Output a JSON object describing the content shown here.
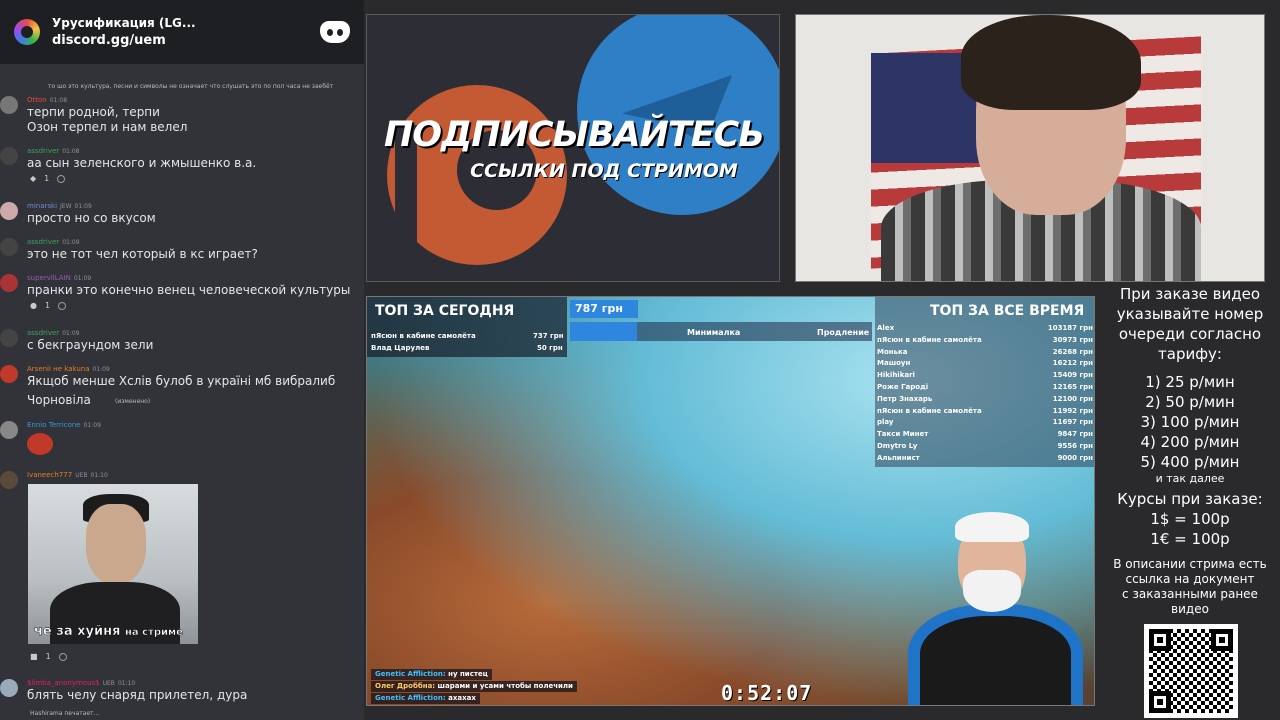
{
  "discord": {
    "server_name": "Урусификация (LG...",
    "server_link": "discord.gg/uem",
    "messages": [
      {
        "small_text": "то шо это культура, песни и символы не означает что слушать это по пол часа не заебёт"
      },
      {
        "user": "Otton",
        "color": "#e74c3c",
        "time": "01:08",
        "lines": [
          "терпи родной, терпи",
          "Озон терпел и нам велел"
        ]
      },
      {
        "user": "assdriver",
        "color": "#3ba55d",
        "time": "01:08",
        "lines": [
          "аа сын зеленского и жмышенко в.а."
        ],
        "reaction": "1"
      },
      {
        "user": "minarski",
        "color": "#7289da",
        "tag": "JEW",
        "time": "01:09",
        "lines": [
          "просто но со вкусом"
        ]
      },
      {
        "user": "assdriver",
        "color": "#3ba55d",
        "time": "01:09",
        "lines": [
          "это не тот чел который в кс играет?"
        ]
      },
      {
        "user": "supervilLAIN",
        "color": "#9b59b6",
        "time": "01:09",
        "lines": [
          "пранки это конечно венец человеческой культуры"
        ],
        "reaction": "1"
      },
      {
        "user": "assdriver",
        "color": "#3ba55d",
        "time": "01:09",
        "lines": [
          "с бекграундом зели"
        ]
      },
      {
        "user": "Arsenii не kakuna",
        "color": "#e67e22",
        "time": "01:09",
        "lines": [
          "Якщоб менше Хслів булоб в україні мб вибралиб",
          "Чорновіла"
        ],
        "edited": "(изменено)"
      },
      {
        "user": "Ennio Terricone",
        "color": "#3498db",
        "time": "01:09",
        "lines": []
      },
      {
        "user": "Ivaneech777",
        "color": "#e67e22",
        "tag": "UEB",
        "time": "01:10",
        "lines": [],
        "reaction": "1"
      },
      {
        "user": "$limba_anonymous$",
        "color": "#e91e63",
        "tag": "UEB",
        "time": "01:10",
        "lines": [
          "блять челу снаряд прилетел, дура"
        ]
      }
    ],
    "meme_caption": "че за хуйня",
    "meme_caption_small": "на стриме",
    "typing": "Hashirama печатает..."
  },
  "promo": {
    "title": "ПОДПИСЫВАЙТЕСЬ",
    "subtitle": "ССЫЛКИ ПОД СТРИМОМ"
  },
  "stream": {
    "top_today_title": "ТОП ЗА СЕГОДНЯ",
    "top_today": [
      {
        "name": "пЯсюн в кабине самолёта",
        "amount": "737 грн"
      },
      {
        "name": "Влад Царулев",
        "amount": "50 грн"
      }
    ],
    "goal_amount": "787 грн",
    "goal_label_min": "Минималка",
    "goal_label_ext": "Продление",
    "top_all_title": "ТОП ЗА ВСЕ ВРЕМЯ",
    "top_all": [
      {
        "name": "Alex",
        "amount": "103187 грн"
      },
      {
        "name": "пЯсюн в кабине самолёта",
        "amount": "30973 грн"
      },
      {
        "name": "Монька",
        "amount": "26268 грн"
      },
      {
        "name": "Машоун",
        "amount": "16212 грн"
      },
      {
        "name": "Hikihikari",
        "amount": "15409 грн"
      },
      {
        "name": "Роже Гароді",
        "amount": "12165 грн"
      },
      {
        "name": "Петр Знахарь",
        "amount": "12100 грн"
      },
      {
        "name": "пЯсюн в кабине самолёта",
        "amount": "11992 грн"
      },
      {
        "name": "play",
        "amount": "11697 грн"
      },
      {
        "name": "Такси Минет",
        "amount": "9847 грн"
      },
      {
        "name": "Dmytro Ly",
        "amount": "9556 грн"
      },
      {
        "name": "Альпинист",
        "amount": "9000 грн"
      }
    ],
    "chat": [
      {
        "name": "Genetic Affliction:",
        "text": "ну пистец"
      },
      {
        "name": "Олег Дроббна:",
        "text": "шарами и усами чтобы полечили"
      },
      {
        "name": "Genetic Affliction:",
        "text": "ахахах"
      }
    ],
    "timer": "0:52:07"
  },
  "info": {
    "intro": [
      "При заказе видео",
      "указывайте номер",
      "очереди согласно",
      "тарифу:"
    ],
    "tariffs": [
      "1) 25 р/мин",
      "2) 50 р/мин",
      "3) 100 р/мин",
      "4) 200 р/мин",
      "5) 400 р/мин"
    ],
    "etc": "и так далее",
    "rates_title": "Курсы при заказе:",
    "rates": [
      "1$ = 100р",
      "1€ = 100р"
    ],
    "desc": [
      "В описании стрима есть",
      "ссылка на документ",
      "с заказанными ранее",
      "видео"
    ]
  }
}
